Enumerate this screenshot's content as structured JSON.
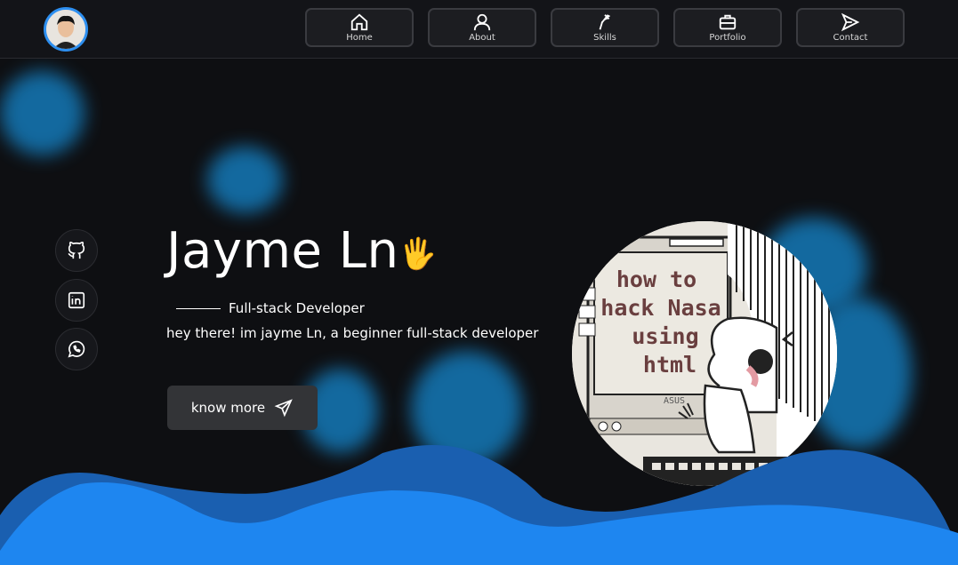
{
  "header": {
    "avatar_alt": "profile photo",
    "nav": [
      {
        "label": "Home",
        "icon": "home-icon"
      },
      {
        "label": "About",
        "icon": "user-icon"
      },
      {
        "label": "Skills",
        "icon": "skills-icon"
      },
      {
        "label": "Portfolio",
        "icon": "briefcase-icon"
      },
      {
        "label": "Contact",
        "icon": "send-icon"
      }
    ]
  },
  "socials": [
    {
      "name": "github",
      "icon": "github-icon"
    },
    {
      "name": "linkedin",
      "icon": "linkedin-icon"
    },
    {
      "name": "whatsapp",
      "icon": "whatsapp-icon"
    }
  ],
  "hero": {
    "name": "Jayme Ln",
    "emoji": "🖐",
    "role": "Full-stack Developer",
    "intro": "hey there! im jayme Ln, a beginner full-stack developer",
    "cta_label": "know more"
  },
  "illustration": {
    "screen_text": [
      "how to",
      "hack Nasa",
      "using",
      "html"
    ],
    "brand": "ASUS"
  },
  "colors": {
    "background": "#0e0f12",
    "accent": "#2d8ff0",
    "wave_front": "#1e86f0",
    "wave_back": "#1a5fb0"
  }
}
